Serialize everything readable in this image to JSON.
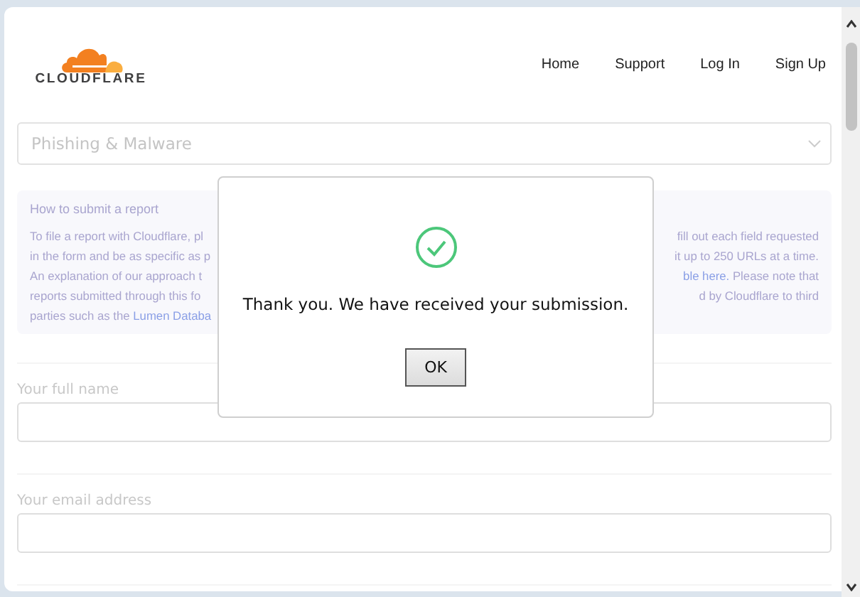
{
  "header": {
    "logo_text": "CLOUDFLARE",
    "nav": [
      "Home",
      "Support",
      "Log In",
      "Sign Up"
    ]
  },
  "category_select": {
    "value": "Phishing & Malware"
  },
  "info": {
    "title": "How to submit a report",
    "lines": [
      {
        "left": [
          {
            "text": "To file a report with Cloudflare, pl",
            "link": false
          }
        ],
        "right": [
          {
            "text": "fill out each field requested",
            "link": false
          }
        ]
      },
      {
        "left": [
          {
            "text": "in the form and be as specific as p",
            "link": false
          }
        ],
        "right": [
          {
            "text": "it up to 250 URLs at a time.",
            "link": false
          }
        ]
      },
      {
        "left": [
          {
            "text": "An explanation of our approach t",
            "link": false
          }
        ],
        "right": [
          {
            "text": "ble here.",
            "link": true
          },
          {
            "text": " Please note that",
            "link": false
          }
        ]
      },
      {
        "left": [
          {
            "text": "reports submitted through this fo",
            "link": false
          }
        ],
        "right": [
          {
            "text": "d by Cloudflare to third",
            "link": false
          }
        ]
      },
      {
        "left": [
          {
            "text": "parties such as the ",
            "link": false
          },
          {
            "text": "Lumen Databa",
            "link": true
          }
        ]
      }
    ]
  },
  "fields": [
    {
      "label": "Your full name"
    },
    {
      "label": "Your email address"
    }
  ],
  "dialog": {
    "message": "Thank you. We have received your submission.",
    "button": "OK"
  }
}
